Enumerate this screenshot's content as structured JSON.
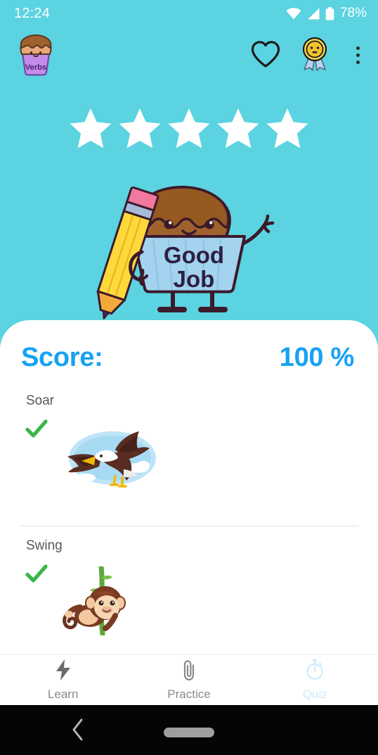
{
  "status_bar": {
    "time": "12:24",
    "battery_percent": "78%",
    "icons": [
      "wifi-icon",
      "signal-icon",
      "battery-icon"
    ]
  },
  "app_bar": {
    "logo_label": "Verbs",
    "logo_icon": "cupcake-logo-icon",
    "actions": [
      {
        "name": "favorite-button",
        "icon": "heart-outline-icon"
      },
      {
        "name": "awards-button",
        "icon": "medal-ribbon-icon"
      },
      {
        "name": "overflow-menu-button",
        "icon": "more-vertical-icon"
      }
    ]
  },
  "hero": {
    "stars_total": 5,
    "stars_filled": 5,
    "mascot_icon": "cupcake-mascot-with-pencil-icon",
    "mascot_text_line1": "Good",
    "mascot_text_line2": "Job",
    "background_color": "#5BD3E0"
  },
  "results_card": {
    "score_label": "Score:",
    "score_value": "100 %",
    "score_color": "#17A2F3",
    "check_color": "#3BB54A",
    "items": [
      {
        "word": "Soar",
        "status_icon": "green-check-icon",
        "correct": true,
        "image_icon": "eagle-soaring-image"
      },
      {
        "word": "Swing",
        "status_icon": "green-check-icon",
        "correct": true,
        "image_icon": "monkey-swinging-image"
      }
    ]
  },
  "tab_bar": {
    "active": "Quiz",
    "tabs": [
      {
        "label": "Learn",
        "icon": "lightning-bolt-icon",
        "active": false
      },
      {
        "label": "Practice",
        "icon": "paperclip-icon",
        "active": false
      },
      {
        "label": "Quiz",
        "icon": "stopwatch-icon",
        "active": true
      }
    ]
  },
  "android_nav": {
    "back_icon": "chevron-left-icon",
    "home_icon": "home-pill-icon"
  }
}
